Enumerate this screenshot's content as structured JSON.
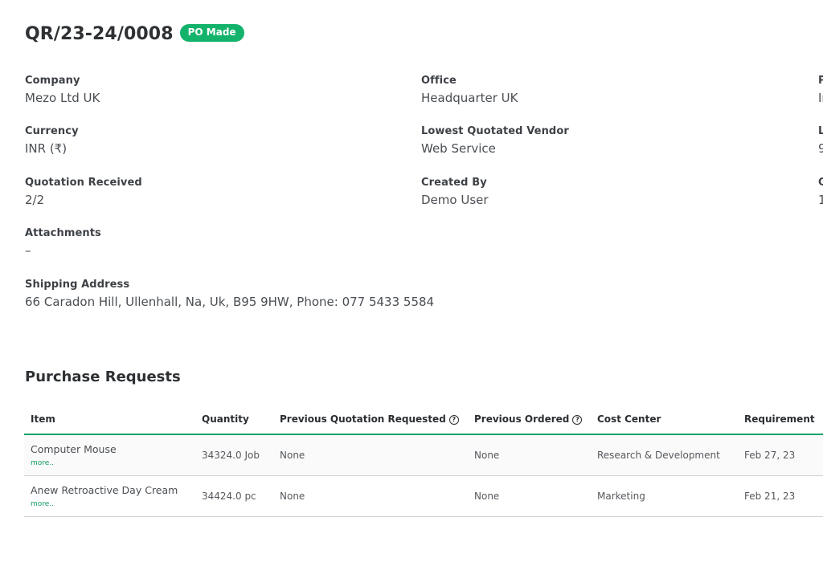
{
  "header": {
    "title": "QR/23-24/0008",
    "status_badge": "PO Made"
  },
  "details": {
    "company": {
      "label": "Company",
      "value": "Mezo Ltd UK"
    },
    "office": {
      "label": "Office",
      "value": "Headquarter UK"
    },
    "col3_row1": {
      "label": "P",
      "value": "In"
    },
    "currency": {
      "label": "Currency",
      "value": "INR (₹)"
    },
    "lowest_vendor": {
      "label": "Lowest Quotated Vendor",
      "value": "Web Service"
    },
    "col3_row2": {
      "label": "L",
      "value": "9"
    },
    "quotation_received": {
      "label": "Quotation Received",
      "value": "2/2"
    },
    "created_by": {
      "label": "Created By",
      "value": "Demo User"
    },
    "col3_row3": {
      "label": "C",
      "value": "1"
    },
    "attachments": {
      "label": "Attachments",
      "value": "–"
    },
    "shipping_address": {
      "label": "Shipping Address",
      "value": "66 Caradon Hill, Ullenhall, Na, Uk, B95 9HW, Phone: 077 5433 5584"
    }
  },
  "purchase_requests": {
    "title": "Purchase Requests",
    "columns": {
      "item": "Item",
      "quantity": "Quantity",
      "prev_quotation": "Previous Quotation Requested",
      "prev_ordered": "Previous Ordered",
      "cost_center": "Cost Center",
      "requirement": "Requirement"
    },
    "help_icon_glyph": "?",
    "more_label": "more..",
    "rows": [
      {
        "item": "Computer Mouse",
        "quantity": "34324.0 Job",
        "prev_quotation": "None",
        "prev_ordered": "None",
        "cost_center": "Research & Development",
        "requirement": "Feb 27, 23"
      },
      {
        "item": "Anew Retroactive Day Cream",
        "quantity": "34424.0 pc",
        "prev_quotation": "None",
        "prev_ordered": "None",
        "cost_center": "Marketing",
        "requirement": "Feb 21, 23"
      }
    ]
  },
  "colors": {
    "accent": "#14b36b",
    "link": "#139a63",
    "text": "#303336"
  }
}
